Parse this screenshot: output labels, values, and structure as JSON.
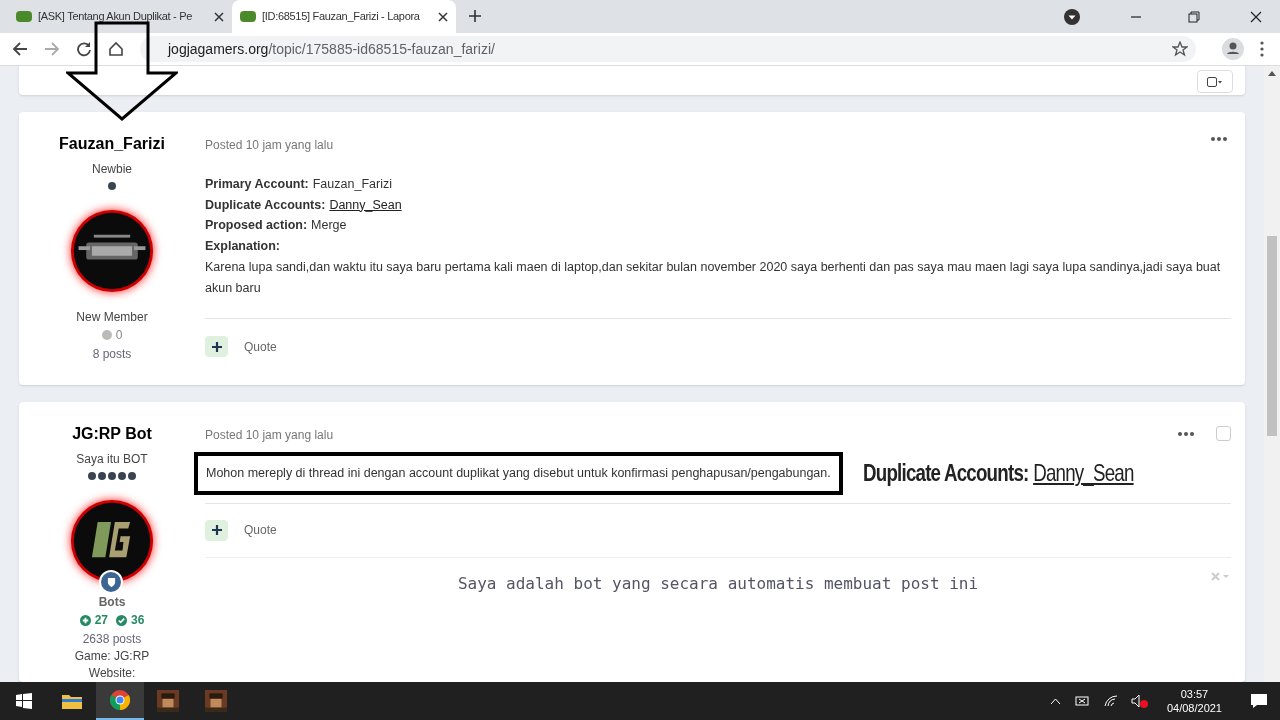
{
  "browser": {
    "tabs": [
      {
        "title": "[ASK] Tentang Akun Duplikat - Pe",
        "selected": false
      },
      {
        "title": "[ID:68515] Fauzan_Farizi - Lapora",
        "selected": true
      }
    ],
    "url_domain": "jogjagamers.org",
    "url_path": "/topic/175885-id68515-fauzan_farizi/"
  },
  "posts": [
    {
      "author": "Fauzan_Farizi",
      "title": "Newbie",
      "pips": [
        {
          "kind": "filled"
        }
      ],
      "rank": "New Member",
      "reputation": "0",
      "post_count": "8 posts",
      "posted": "Posted 10 jam yang lalu",
      "fields": [
        {
          "label": "Primary Account:",
          "value": "Fauzan_Farizi",
          "kind": "text"
        },
        {
          "label": "Duplicate Accounts:",
          "value": "Danny_Sean",
          "kind": "link"
        },
        {
          "label": "Proposed action:",
          "value": "Merge",
          "kind": "text"
        },
        {
          "label": "Explanation:",
          "kind": "text"
        }
      ],
      "paragraph": "Karena lupa sandi,dan waktu itu saya baru pertama kali maen di laptop,dan sekitar bulan november 2020 saya berhenti dan pas saya mau maen lagi saya lupa sandinya,jadi saya buat akun baru",
      "quote": "Quote"
    },
    {
      "author": "JG:RP Bot",
      "title": "Saya itu BOT",
      "pips": [
        {
          "kind": "filled"
        },
        {
          "kind": "filled"
        },
        {
          "kind": "filled"
        },
        {
          "kind": "filled"
        },
        {
          "kind": "filled"
        }
      ],
      "group": "Bots",
      "rep_up": "27",
      "rep_check": "36",
      "post_count": "2638 posts",
      "game": "Game: JG:RP",
      "website": "Website:",
      "posted": "Posted 10 jam yang lalu",
      "checked": false,
      "paragraph": "Mohon mereply di thread ini dengan account duplikat yang disebut untuk konfirmasi penghapusan/pengabungan.",
      "highlighted": true,
      "quote": "Quote",
      "signature": "Saya adalah bot yang secara automatis membuat post ini"
    }
  ],
  "annotation": {
    "label": "Duplicate Accounts:",
    "value": "Danny_Sean"
  },
  "taskbar": {
    "apps": [
      {
        "kind": "start",
        "selected": false
      },
      {
        "kind": "folder",
        "selected": false
      },
      {
        "kind": "chrome",
        "selected": true
      },
      {
        "kind": "game",
        "selected": false
      },
      {
        "kind": "game",
        "selected": false
      }
    ],
    "time": "03:57",
    "date": "04/08/2021"
  }
}
